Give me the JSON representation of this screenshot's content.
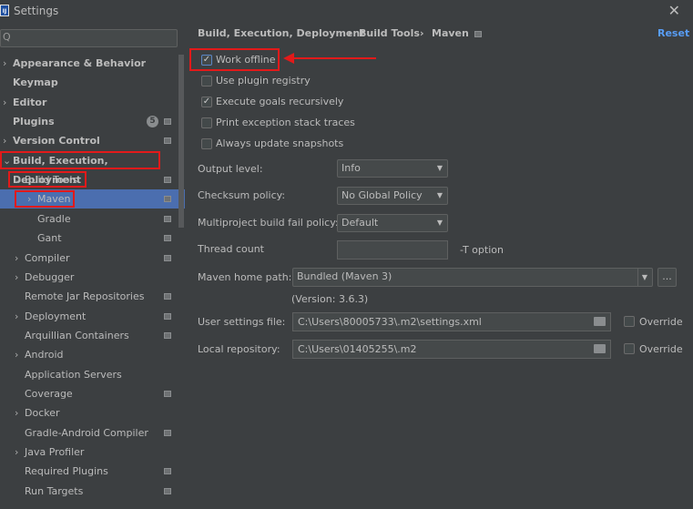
{
  "window": {
    "title": "Settings",
    "close": "✕",
    "logo": "IJ"
  },
  "search": {
    "icon": "Q",
    "placeholder": ""
  },
  "tree": [
    {
      "label": "Appearance & Behavior",
      "level": 0,
      "arrow": "›",
      "bold": true
    },
    {
      "label": "Keymap",
      "level": 0,
      "arrow": "",
      "bold": true
    },
    {
      "label": "Editor",
      "level": 0,
      "arrow": "›",
      "bold": true
    },
    {
      "label": "Plugins",
      "level": 0,
      "arrow": "",
      "bold": true,
      "badge": "5",
      "proj": true
    },
    {
      "label": "Version Control",
      "level": 0,
      "arrow": "›",
      "bold": true,
      "proj": true
    },
    {
      "label": "Build, Execution, Deployment",
      "level": 0,
      "arrow": "⌄",
      "bold": true
    },
    {
      "label": "Build Tools",
      "level": 1,
      "arrow": "⌄",
      "proj": true
    },
    {
      "label": "Maven",
      "level": 2,
      "arrow": "›",
      "proj": true,
      "selected": true
    },
    {
      "label": "Gradle",
      "level": 2,
      "arrow": "",
      "proj": true
    },
    {
      "label": "Gant",
      "level": 2,
      "arrow": "",
      "proj": true
    },
    {
      "label": "Compiler",
      "level": 1,
      "arrow": "›",
      "proj": true
    },
    {
      "label": "Debugger",
      "level": 1,
      "arrow": "›"
    },
    {
      "label": "Remote Jar Repositories",
      "level": 1,
      "arrow": "",
      "proj": true
    },
    {
      "label": "Deployment",
      "level": 1,
      "arrow": "›",
      "proj": true
    },
    {
      "label": "Arquillian Containers",
      "level": 1,
      "arrow": "",
      "proj": true
    },
    {
      "label": "Android",
      "level": 1,
      "arrow": "›"
    },
    {
      "label": "Application Servers",
      "level": 1,
      "arrow": ""
    },
    {
      "label": "Coverage",
      "level": 1,
      "arrow": "",
      "proj": true
    },
    {
      "label": "Docker",
      "level": 1,
      "arrow": "›"
    },
    {
      "label": "Gradle-Android Compiler",
      "level": 1,
      "arrow": "",
      "proj": true
    },
    {
      "label": "Java Profiler",
      "level": 1,
      "arrow": "›"
    },
    {
      "label": "Required Plugins",
      "level": 1,
      "arrow": "",
      "proj": true
    },
    {
      "label": "Run Targets",
      "level": 1,
      "arrow": "",
      "proj": true
    }
  ],
  "breadcrumb": [
    "Build, Execution, Deployment",
    "Build Tools",
    "Maven"
  ],
  "breadcrumb_sep": "›",
  "reset": "Reset",
  "checkboxes": [
    {
      "label": "Work offline",
      "checked": true
    },
    {
      "label": "Use plugin registry",
      "checked": false
    },
    {
      "label": "Execute goals recursively",
      "checked": true
    },
    {
      "label": "Print exception stack traces",
      "checked": false
    },
    {
      "label": "Always update snapshots",
      "checked": false
    }
  ],
  "fields": {
    "output_level": {
      "label": "Output level:",
      "value": "Info"
    },
    "checksum": {
      "label": "Checksum policy:",
      "value": "No Global Policy"
    },
    "multiproject": {
      "label": "Multiproject build fail policy:",
      "value": "Default"
    },
    "thread": {
      "label": "Thread count",
      "value": "",
      "suffix": "-T option"
    },
    "maven_home": {
      "label": "Maven home path:",
      "value": "Bundled (Maven 3)",
      "browse": "...",
      "version": "(Version: 3.6.3)"
    },
    "user_settings": {
      "label": "User settings file:",
      "value": "C:\\Users\\80005733\\.m2\\settings.xml",
      "override": "Override"
    },
    "local_repo": {
      "label": "Local repository:",
      "value": "C:\\Users\\01405255\\.m2",
      "override": "Override"
    }
  },
  "accent": "#4b6eaf",
  "highlight": "#e21a1a"
}
